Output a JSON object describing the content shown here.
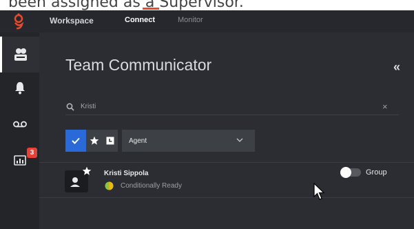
{
  "caption": {
    "text": "been assigned as a Supervisor."
  },
  "topbar": {
    "tabs": [
      {
        "label": "Workspace"
      },
      {
        "label": "Connect"
      },
      {
        "label": "Monitor"
      }
    ]
  },
  "sidebar": {
    "items": [
      {
        "icon": "team-communicator-icon",
        "active": true
      },
      {
        "icon": "bell-icon"
      },
      {
        "icon": "voicemail-icon"
      },
      {
        "icon": "dashboard-icon",
        "badge": "3"
      }
    ]
  },
  "panel": {
    "title": "Team Communicator",
    "collapse_label": "«"
  },
  "search": {
    "value": "Kristi",
    "clear_label": "×"
  },
  "filters": {
    "type_value": "Agent",
    "group_label": "Group",
    "group_toggle_on": false
  },
  "results": [
    {
      "name": "Kristi Sippola",
      "status": "Conditionally Ready",
      "favorite": true
    }
  ],
  "colors": {
    "accent": "#2a6ad8",
    "status_ready": "#8bc34a",
    "status_not_ready": "#f5b800",
    "badge": "#e84037",
    "logo": "#e94a2c"
  }
}
